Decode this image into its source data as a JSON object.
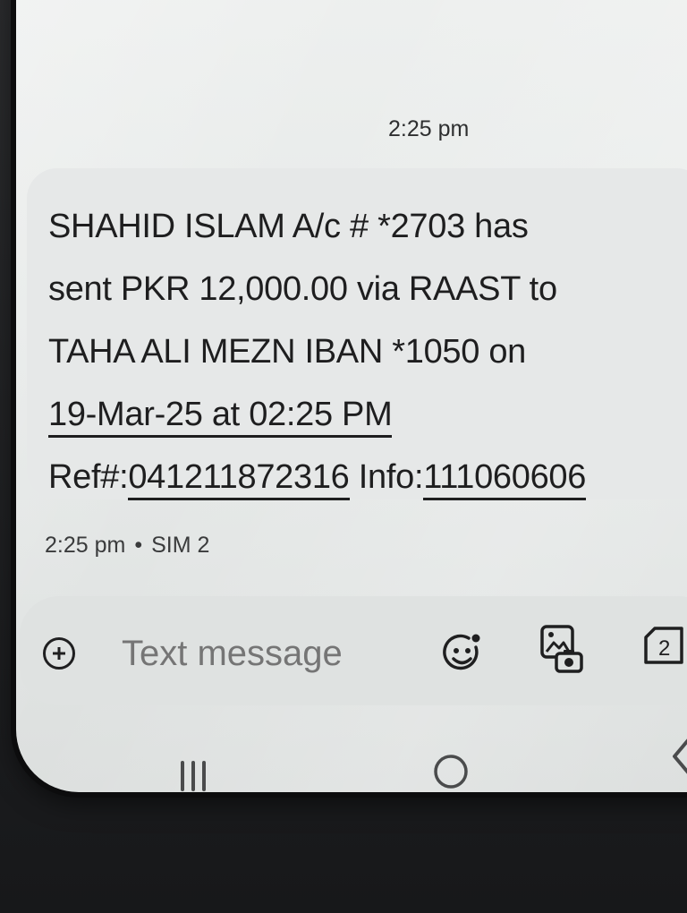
{
  "message": {
    "time_header": "2:25 pm",
    "lines": [
      "SHAHID ISLAM A/c # *2703 has",
      "sent PKR 12,000.00 via RAAST to",
      "TAHA ALI MEZN IBAN *1050 on"
    ],
    "date_link": "19-Mar-25 at 02:25 PM",
    "ref_label": "Ref#:",
    "ref_value": "041211872316",
    "info_label": " Info:",
    "info_value": "111060606",
    "meta_time": "2:25 pm",
    "meta_sep": "•",
    "meta_sim": "SIM 2"
  },
  "composer": {
    "placeholder": "Text message",
    "sim_badge": "2"
  },
  "icons": {
    "add": "plus-circle-icon",
    "emoji": "emoji-icon",
    "gallery": "gallery-icon",
    "sim": "sim-icon",
    "recents": "recents-icon",
    "home": "home-icon",
    "back": "back-icon"
  }
}
